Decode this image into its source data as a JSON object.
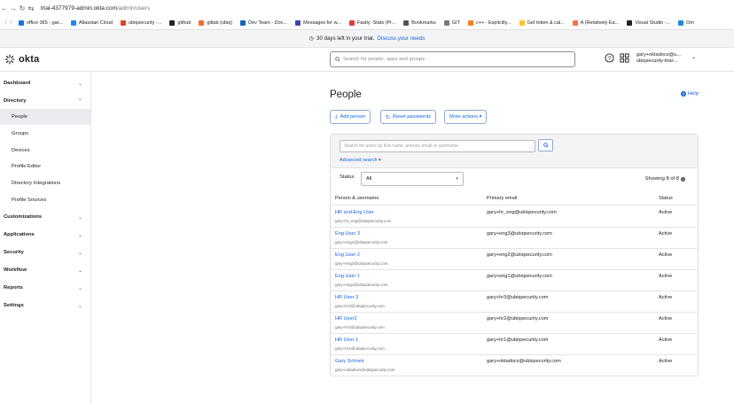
{
  "browser": {
    "url_host": "trial-4377979-admin.okta.com",
    "url_path": "/admin/users",
    "bookmarks": [
      {
        "label": "office 365 - gar...",
        "color": "#1a73e8"
      },
      {
        "label": "Atlassian Cloud",
        "color": "#2684ff"
      },
      {
        "label": "ubiqsecurity -...",
        "color": "#e24329"
      },
      {
        "label": "github",
        "color": "#222222"
      },
      {
        "label": "gitlab (ubiq)",
        "color": "#fc6d26"
      },
      {
        "label": "Dev Team - Doc...",
        "color": "#1565c0"
      },
      {
        "label": "Messages for w...",
        "color": "#3949ab"
      },
      {
        "label": "Fastly: Stats (Pr...",
        "color": "#e53935"
      },
      {
        "label": "Bookmarks",
        "color": "#555555"
      },
      {
        "label": "GIT",
        "color": "#777777"
      },
      {
        "label": "c++ - Explicitly...",
        "color": "#f48024"
      },
      {
        "label": "Get token & cal...",
        "color": "#fbc02d"
      },
      {
        "label": "A (Relatively Ea...",
        "color": "#ff7043"
      },
      {
        "label": "Visual Studio -...",
        "color": "#222222"
      },
      {
        "label": "Om",
        "color": "#1e88e5"
      }
    ]
  },
  "banner": {
    "text": "30 days left in your trial.",
    "link": "Discuss your needs"
  },
  "header": {
    "logo_text": "okta",
    "search_placeholder": "Search for people, apps and groups",
    "user_line1": "gary+oktadocs@u...",
    "user_line2": "ubiqsecurity-trial-..."
  },
  "sidebar": {
    "items": [
      {
        "label": "Dashboard",
        "kind": "section",
        "chev": "⌄"
      },
      {
        "label": "Directory",
        "kind": "section",
        "chev": "⌃"
      },
      {
        "label": "People",
        "kind": "sub",
        "active": true
      },
      {
        "label": "Groups",
        "kind": "sub"
      },
      {
        "label": "Devices",
        "kind": "sub"
      },
      {
        "label": "Profile Editor",
        "kind": "sub"
      },
      {
        "label": "Directory Integrations",
        "kind": "sub"
      },
      {
        "label": "Profile Sources",
        "kind": "sub"
      },
      {
        "label": "Customizations",
        "kind": "section",
        "chev": "⌄"
      },
      {
        "label": "Applications",
        "kind": "section",
        "chev": "⌄"
      },
      {
        "label": "Security",
        "kind": "section",
        "chev": "⌄"
      },
      {
        "label": "Workflow",
        "kind": "section",
        "chev": "⌄"
      },
      {
        "label": "Reports",
        "kind": "section",
        "chev": "⌄"
      },
      {
        "label": "Settings",
        "kind": "section",
        "chev": "⌄"
      }
    ]
  },
  "main": {
    "title": "People",
    "help": "Help",
    "add_person": "Add person",
    "reset_passwords": "Reset passwords",
    "more_actions": "More actions ▾",
    "search_placeholder": "Search for users by first name, primary email or username",
    "advanced_search": "Advanced search ▾",
    "status_label": "Status",
    "status_value": "All",
    "showing": "Showing 8 of 8",
    "columns": [
      "Person & username",
      "Primary email",
      "Status"
    ],
    "rows": [
      {
        "name": "HR and Eng User",
        "username": "gary+hr_eng@ubiqsecurity.com",
        "email": "gary+hr_eng@ubiqsecurity.com",
        "status": "Active"
      },
      {
        "name": "Eng User 3",
        "username": "gary+eng3@ubiqsecurity.com",
        "email": "gary+eng3@ubiqsecurity.com",
        "status": "Active"
      },
      {
        "name": "Eng User 2",
        "username": "gary+eng2@ubiqsecurity.com",
        "email": "gary+eng2@ubiqsecurity.com",
        "status": "Active"
      },
      {
        "name": "Eng User 1",
        "username": "gary+eng1@ubiqsecurity.com",
        "email": "gary+eng1@ubiqsecurity.com",
        "status": "Active"
      },
      {
        "name": "HR User 3",
        "username": "gary+hr3@ubiqsecurity.com",
        "email": "gary+hr3@ubiqsecurity.com",
        "status": "Active"
      },
      {
        "name": "HR User2",
        "username": "gary+hr2@ubiqsecurity.com",
        "email": "gary+hr2@ubiqsecurity.com",
        "status": "Active"
      },
      {
        "name": "HR User 1",
        "username": "gary+hr1@ubiqsecurity.com",
        "email": "gary+hr1@ubiqsecurity.com",
        "status": "Active"
      },
      {
        "name": "Gary Schneir",
        "username": "gary+oktadocs@ubiqsecurity.com",
        "email": "gary+oktadocs@ubiqsecurity.com",
        "status": "Active"
      }
    ]
  }
}
